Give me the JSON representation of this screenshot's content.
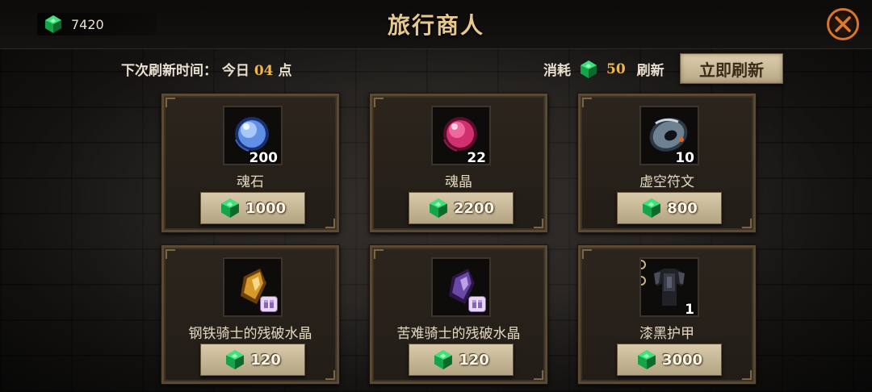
{
  "header": {
    "currency_amount": "7420",
    "title": "旅行商人"
  },
  "refresh": {
    "label_prefix": "下次刷新时间：",
    "day": "今日",
    "hour": "04",
    "suffix": "点",
    "cost_label": "消耗",
    "cost_amount": "50",
    "cost_action": "刷新",
    "button_label": "立即刷新"
  },
  "items": [
    {
      "name": "魂石",
      "qty": "200",
      "price": "1000",
      "icon": "blue-orb-icon"
    },
    {
      "name": "魂晶",
      "qty": "22",
      "price": "2200",
      "icon": "red-orb-icon"
    },
    {
      "name": "虚空符文",
      "qty": "10",
      "price": "800",
      "icon": "void-rune-icon"
    },
    {
      "name": "钢铁骑士的残破水晶",
      "qty": "",
      "price": "120",
      "icon": "gold-crystal-icon"
    },
    {
      "name": "苦难骑士的残破水晶",
      "qty": "",
      "price": "120",
      "icon": "purple-crystal-icon"
    },
    {
      "name": "漆黑护甲",
      "qty": "1",
      "price": "3000",
      "icon": "black-armor-icon"
    }
  ],
  "colors": {
    "gem": "#1fc25a",
    "accent_gold": "#efb64b",
    "title": "#e6c98e"
  }
}
